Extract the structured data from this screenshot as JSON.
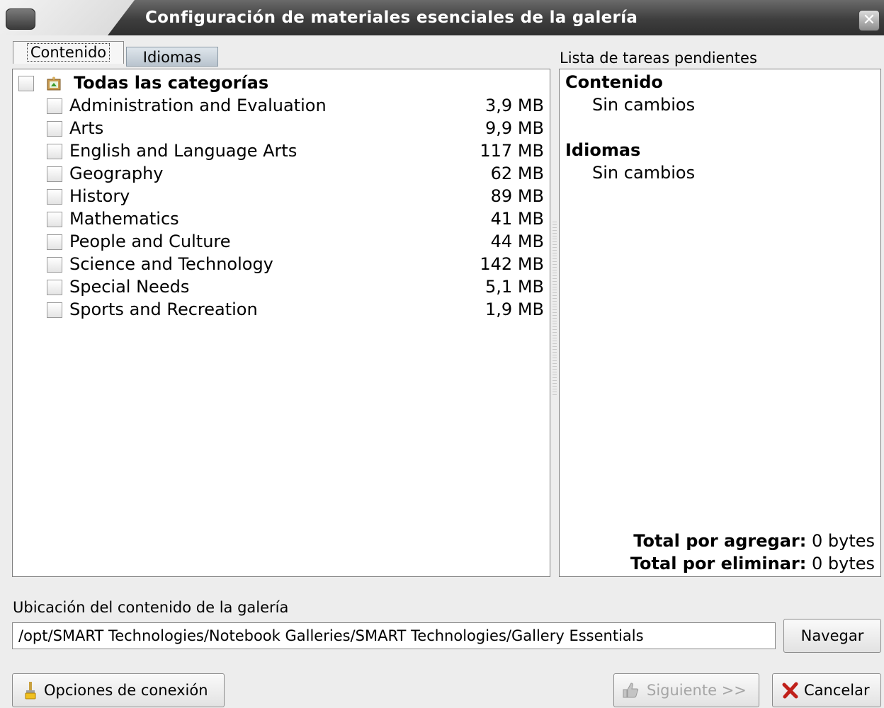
{
  "window": {
    "title": "Configuración de materiales esenciales de la galería",
    "close_glyph": "✕"
  },
  "tabs": [
    {
      "label": "Contenido",
      "active": true
    },
    {
      "label": "Idiomas",
      "active": false
    }
  ],
  "categories": {
    "root_label": "Todas las categorías",
    "root_icon": "gallery-icon",
    "items": [
      {
        "name": "Administration and Evaluation",
        "size": "3,9 MB"
      },
      {
        "name": "Arts",
        "size": "9,9 MB"
      },
      {
        "name": "English and Language Arts",
        "size": "117 MB"
      },
      {
        "name": "Geography",
        "size": "62 MB"
      },
      {
        "name": "History",
        "size": "89 MB"
      },
      {
        "name": "Mathematics",
        "size": "41 MB"
      },
      {
        "name": "People and Culture",
        "size": "44 MB"
      },
      {
        "name": "Science and Technology",
        "size": "142 MB"
      },
      {
        "name": "Special Needs",
        "size": "5,1 MB"
      },
      {
        "name": "Sports and Recreation",
        "size": "1,9 MB"
      }
    ]
  },
  "pending": {
    "label": "Lista de tareas pendientes",
    "content_heading": "Contenido",
    "content_status": "Sin cambios",
    "languages_heading": "Idiomas",
    "languages_status": "Sin cambios",
    "total_add_label": "Total por agregar:",
    "total_add_value": "0 bytes",
    "total_remove_label": "Total por eliminar:",
    "total_remove_value": "0 bytes"
  },
  "location": {
    "label": "Ubicación del contenido de la galería",
    "path": "/opt/SMART Technologies/Notebook Galleries/SMART Technologies/Gallery Essentials",
    "browse_label": "Navegar"
  },
  "footer": {
    "connection_label": "Opciones de conexión",
    "next_label": "Siguiente >>",
    "cancel_label": "Cancelar"
  },
  "colors": {
    "titlebar": "#3e3e3e",
    "panel_bg": "#ffffff",
    "window_bg": "#ededed",
    "disabled_text": "#a5a5a5",
    "cancel_icon": "#c0201a"
  }
}
